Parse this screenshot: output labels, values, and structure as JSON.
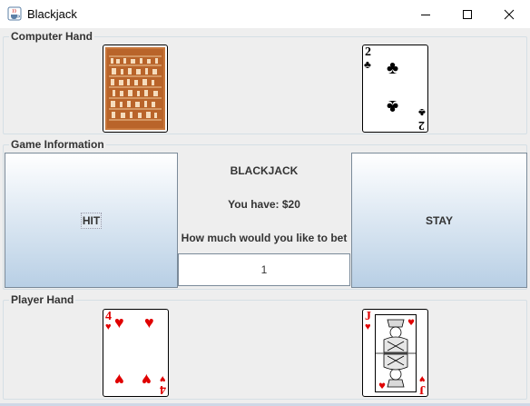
{
  "window": {
    "title": "Blackjack"
  },
  "computer_hand": {
    "legend": "Computer Hand",
    "cards": [
      {
        "face": "back",
        "icon": "card-back-icon"
      },
      {
        "face": "up",
        "rank": "2",
        "suit": "♣",
        "color": "#000000"
      }
    ]
  },
  "game_info": {
    "legend": "Game Information",
    "heading": "BLACKJACK",
    "balance_text": "You have: $20",
    "prompt": "How much would you like to bet",
    "bet_value": "1",
    "hit_label": "HIT",
    "stay_label": "STAY"
  },
  "player_hand": {
    "legend": "Player Hand",
    "cards": [
      {
        "face": "up",
        "rank": "4",
        "suit": "♥",
        "color": "#e00000"
      },
      {
        "face": "up",
        "rank": "J",
        "suit": "♥",
        "color": "#e00000"
      }
    ]
  },
  "colors": {
    "button_gradient_top": "#ffffff",
    "button_gradient_bottom": "#b8cfe5",
    "panel_bg": "#eeeeee",
    "red_suit": "#e00000"
  }
}
